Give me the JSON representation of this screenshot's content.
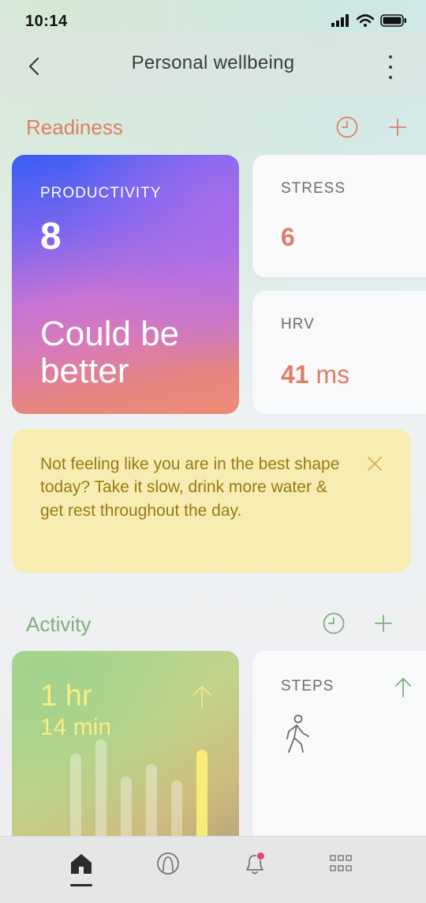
{
  "status_bar": {
    "time": "10:14"
  },
  "header": {
    "title": "Personal wellbeing"
  },
  "readiness": {
    "title": "Readiness",
    "color": "#e07d68",
    "productivity": {
      "label": "PRODUCTIVITY",
      "value": "8",
      "message": "Could be better"
    },
    "stress": {
      "label": "STRESS",
      "value": "6"
    },
    "hrv": {
      "label": "HRV",
      "value": "41",
      "unit": "ms"
    }
  },
  "tip": {
    "text": "Not feeling like you are in the best shape today? Take it slow, drink more water & get rest throughout the day.",
    "color": "#9a7b15"
  },
  "activity": {
    "title": "Activity",
    "color": "#7fb07e",
    "duration": {
      "hours": "1 hr",
      "minutes": "14 min"
    },
    "bar_levels": [
      0.5,
      0.57,
      0.39,
      0.45,
      0.37,
      0.52
    ],
    "highlight_bar_index": 5,
    "steps": {
      "label": "STEPS"
    }
  },
  "nav": {
    "items": [
      "home-icon",
      "ring-icon",
      "notification-bell-icon",
      "apps-grid-icon"
    ],
    "active": "home-icon",
    "notification_dot_color": "#e3476d"
  }
}
